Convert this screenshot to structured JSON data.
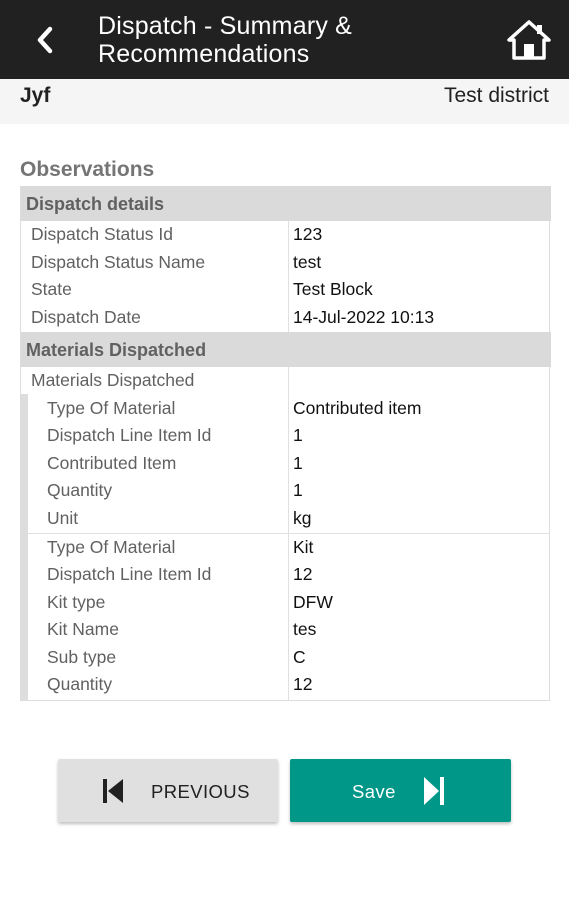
{
  "appbar": {
    "title_line1": "Dispatch - Summary &",
    "title_line2": "Recommendations",
    "back_icon": "chevron-left-icon",
    "home_icon": "home-icon"
  },
  "subheader": {
    "left": "Jyf",
    "right": "Test district"
  },
  "observations": {
    "title": "Observations",
    "dispatch_details": {
      "header": "Dispatch details",
      "rows": [
        {
          "key": "Dispatch Status Id",
          "value": "123"
        },
        {
          "key": "Dispatch Status Name",
          "value": "test"
        },
        {
          "key": "State",
          "value": "Test Block"
        },
        {
          "key": "Dispatch Date",
          "value": "14-Jul-2022 10:13"
        }
      ]
    },
    "materials": {
      "header": "Materials Dispatched",
      "sub_label": "Materials  Dispatched",
      "items": [
        {
          "rows": [
            {
              "key": "Type Of Material",
              "value": "Contributed item"
            },
            {
              "key": "Dispatch Line Item Id",
              "value": "1"
            },
            {
              "key": "Contributed Item",
              "value": "1"
            },
            {
              "key": "Quantity",
              "value": "1"
            },
            {
              "key": "Unit",
              "value": "kg"
            }
          ]
        },
        {
          "rows": [
            {
              "key": "Type Of Material",
              "value": "Kit"
            },
            {
              "key": "Dispatch Line Item Id",
              "value": "12"
            },
            {
              "key": "Kit type",
              "value": "DFW"
            },
            {
              "key": "Kit Name",
              "value": "tes"
            },
            {
              "key": "Sub type",
              "value": "C"
            },
            {
              "key": "Quantity",
              "value": "12"
            }
          ]
        }
      ]
    }
  },
  "buttons": {
    "previous": "PREVIOUS",
    "save": "Save"
  },
  "colors": {
    "appbar": "#212121",
    "save": "#009688",
    "previous": "#e0e0e0"
  }
}
